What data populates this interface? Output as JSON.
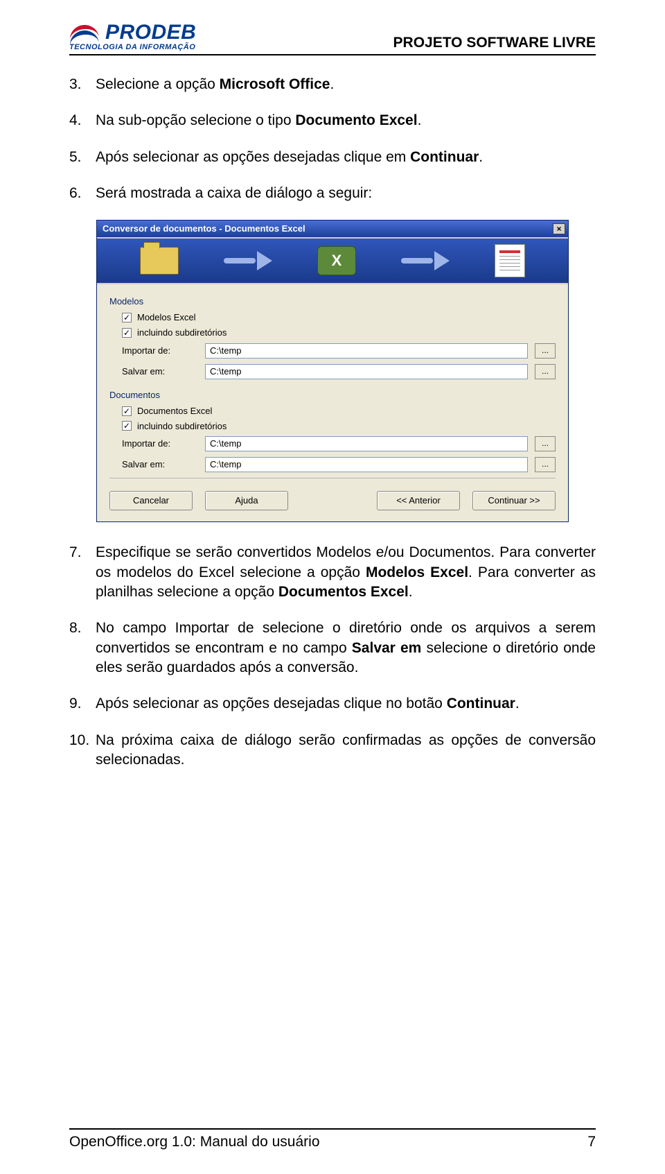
{
  "header": {
    "logo_text": "PRODEB",
    "logo_sub": "TECNOLOGIA DA INFORMAÇÃO",
    "title": "PROJETO SOFTWARE LIVRE"
  },
  "items": {
    "n3": {
      "num": "3.",
      "pre": "Selecione a opção ",
      "bold": "Microsoft Office",
      "post": "."
    },
    "n4": {
      "num": "4.",
      "pre": "Na sub-opção selecione o tipo ",
      "bold": "Documento Excel",
      "post": "."
    },
    "n5": {
      "num": "5.",
      "pre": "Após selecionar as opções desejadas clique em ",
      "bold": "Continuar",
      "post": "."
    },
    "n6": {
      "num": "6.",
      "text": "Será mostrada a caixa de diálogo a seguir:"
    },
    "n7": {
      "num": "7.",
      "a": "Especifique se serão convertidos Modelos e/ou Documentos. Para converter os modelos do Excel selecione a opção ",
      "b": "Modelos Excel",
      "c": ". Para converter as planilhas selecione a opção ",
      "d": "Documentos Excel",
      "e": "."
    },
    "n8": {
      "num": "8.",
      "a": "No campo Importar de selecione o diretório onde os arquivos a serem convertidos se encontram e no campo ",
      "b": "Salvar em",
      "c": " selecione o diretório onde eles serão guardados após a conversão."
    },
    "n9": {
      "num": "9.",
      "a": "Após selecionar as opções desejadas clique no botão ",
      "b": "Continuar",
      "c": "."
    },
    "n10": {
      "num": "10.",
      "text": "Na próxima caixa de diálogo serão confirmadas as opções de conversão selecionadas."
    }
  },
  "dialog": {
    "title": "Conversor de documentos - Documentos Excel",
    "close_glyph": "×",
    "group1_label": "Modelos",
    "chk_modelos": "Modelos Excel",
    "chk_sub1": "incluindo subdiretórios",
    "importar_label": "Importar de:",
    "salvar_label": "Salvar em:",
    "path": "C:\\temp",
    "browse": "...",
    "group2_label": "Documentos",
    "chk_docs": "Documentos Excel",
    "chk_sub2": "incluindo subdiretórios",
    "btn_cancelar": "Cancelar",
    "btn_ajuda": "Ajuda",
    "btn_anterior": "<< Anterior",
    "btn_continuar": "Continuar >>",
    "check_glyph": "✓",
    "x_glyph": "X"
  },
  "footer": {
    "left": "OpenOffice.org 1.0: Manual do usuário",
    "right": "7"
  }
}
